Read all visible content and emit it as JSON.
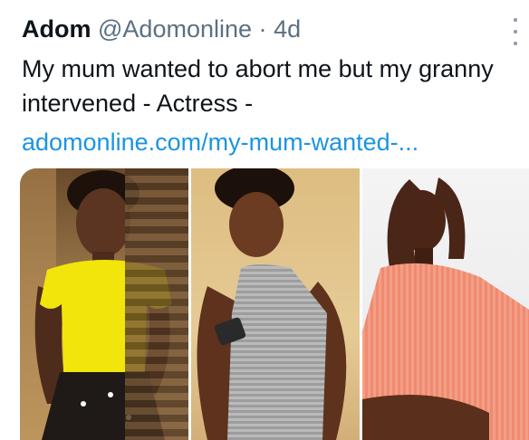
{
  "tweet": {
    "author_name": "Adom",
    "handle": "@Adomonline",
    "separator": "·",
    "time": "4d",
    "text": "My mum wanted to abort me but my granny intervened - Actress -",
    "link": "adomonline.com/my-mum-wanted-..."
  },
  "media": {
    "photos": [
      {
        "description_icon": "photo-woman-yellow-top"
      },
      {
        "description_icon": "photo-woman-grey-dress"
      },
      {
        "description_icon": "photo-woman-pink-sweater"
      }
    ]
  },
  "colors": {
    "text": "#0f1419",
    "secondary": "#5b7083",
    "link": "#1b95e0",
    "yellow_top": "#f1e50c",
    "grey_dress": "#9d9d9d",
    "pink_sweater": "#f08a6e"
  }
}
